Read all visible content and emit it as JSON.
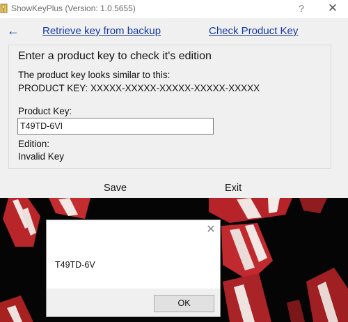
{
  "window": {
    "title": "ShowKeyPlus (Version: 1.0.5655)",
    "help_glyph": "?",
    "close_glyph": "✕",
    "icon": "key-app-icon"
  },
  "nav": {
    "back_icon": "back-arrow-icon",
    "back_glyph": "←",
    "retrieve_link": "Retrieve key from backup",
    "check_link": "Check Product Key"
  },
  "panel": {
    "heading": "Enter a product key to check it's edition",
    "hint_line1": "The product key looks similar to this:",
    "hint_line2": "PRODUCT KEY: XXXXX-XXXXX-XXXXX-XXXXX-XXXXX",
    "key_label": "Product Key:",
    "key_value": "T49TD-6VI",
    "edition_label": "Edition:",
    "edition_value": "Invalid Key"
  },
  "actions": {
    "save": "Save",
    "exit": "Exit"
  },
  "message_box": {
    "close_glyph": "✕",
    "text": "T49TD-6V",
    "ok": "OK"
  },
  "colors": {
    "link": "#1538a5",
    "window_bg": "#f0f0f0",
    "titlebar_bg": "#ffffff",
    "wallpaper_red": "#c8282b"
  }
}
